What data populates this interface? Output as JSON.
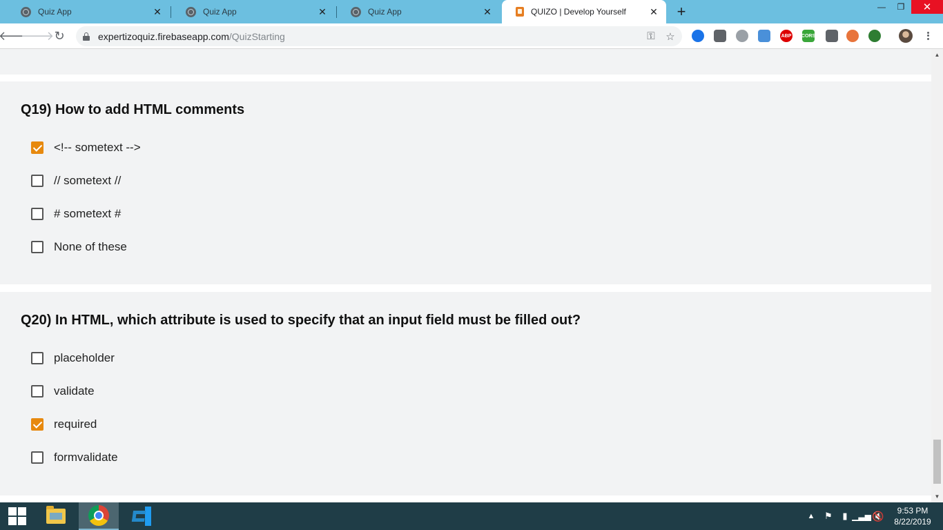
{
  "browser": {
    "tabs": [
      {
        "label": "Quiz App",
        "icon": "globe-icon",
        "active": false
      },
      {
        "label": "Quiz App",
        "icon": "globe-icon",
        "active": false
      },
      {
        "label": "Quiz App",
        "icon": "globe-icon",
        "active": false
      },
      {
        "label": "QUIZO | Develop Yourself",
        "icon": "quizo-favicon",
        "active": true
      }
    ],
    "url": {
      "host": "expertizoquiz.firebaseapp.com",
      "path": "/QuizStarting"
    },
    "extensions": [
      {
        "name": "blue-extension-icon",
        "color": "#1a73e8",
        "text": ""
      },
      {
        "name": "screen-extension-icon",
        "color": "#5f6368",
        "text": ""
      },
      {
        "name": "braces-extension-icon",
        "color": "#9aa0a6",
        "text": ""
      },
      {
        "name": "windows-extension-icon",
        "color": "#4a90d9",
        "text": ""
      },
      {
        "name": "adblock-plus-icon",
        "color": "#d00",
        "text": "ABP"
      },
      {
        "name": "cors-extension-icon",
        "color": "#3aa63a",
        "text": "CORS"
      },
      {
        "name": "eyedropper-extension-icon",
        "color": "#5f6368",
        "text": ""
      },
      {
        "name": "orange-extension-icon",
        "color": "#e8743b",
        "text": ""
      },
      {
        "name": "globe-extension-icon",
        "color": "#2e7d32",
        "text": ""
      }
    ]
  },
  "quiz": {
    "questions": [
      {
        "title": "Q19) How to add HTML comments",
        "options": [
          {
            "label": "<!-- sometext -->",
            "checked": true
          },
          {
            "label": "// sometext //",
            "checked": false
          },
          {
            "label": "# sometext #",
            "checked": false
          },
          {
            "label": "None of these",
            "checked": false
          }
        ]
      },
      {
        "title": "Q20) In HTML, which attribute is used to specify that an input field must be filled out?",
        "options": [
          {
            "label": "placeholder",
            "checked": false
          },
          {
            "label": "validate",
            "checked": false
          },
          {
            "label": "required",
            "checked": true
          },
          {
            "label": "formvalidate",
            "checked": false
          }
        ]
      }
    ]
  },
  "theme": {
    "accent": "#e7890e",
    "tabstrip": "#6cbfe0",
    "card_bg": "#f2f3f4",
    "taskbar": "#1f3d47"
  },
  "taskbar": {
    "apps": [
      "file-explorer-icon",
      "chrome-icon",
      "vscode-icon"
    ],
    "time": "9:53 PM",
    "date": "8/22/2019"
  }
}
